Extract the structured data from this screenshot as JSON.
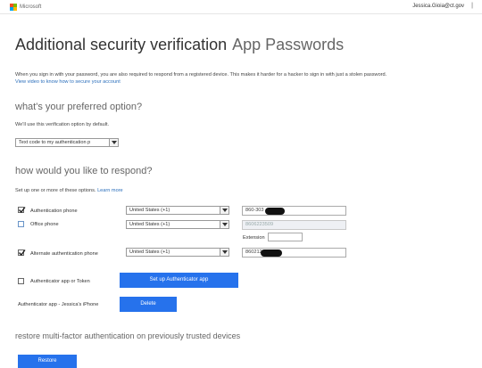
{
  "header": {
    "brand": "Microsoft",
    "user_email": "Jessica.Gioia@ct.gov",
    "separator": "|",
    "logo_colors": [
      "#f25022",
      "#7fba00",
      "#00a4ef",
      "#ffb900"
    ]
  },
  "title": {
    "main": "Additional security verification",
    "sub": "App Passwords"
  },
  "intro": {
    "text": "When you sign in with your password, you are also required to respond from a registered device. This makes it harder for a hacker to sign in with just a stolen password.",
    "link": "View video to know how to secure your account"
  },
  "preferred": {
    "heading": "what's your preferred option?",
    "description": "We'll use this verification option by default.",
    "selected": "Text code to my authentication p"
  },
  "respond": {
    "heading": "how would you like to respond?",
    "description": "Set up one or more of these options.",
    "learn_more": "Learn more",
    "rows": [
      {
        "label": "Authentication phone",
        "checked": true,
        "country": "United States (+1)",
        "number": "860-303"
      },
      {
        "label": "Office phone",
        "checked": false,
        "country": "United States (+1)",
        "number": "8606223509",
        "extension_label": "Extension"
      },
      {
        "label": "Alternate authentication phone",
        "checked": true,
        "country": "United States (+1)",
        "number": "860212"
      }
    ],
    "authenticator": {
      "label": "Authenticator app or Token",
      "checked": false,
      "setup_button": "Set up Authenticator app",
      "device_label": "Authenticator app - Jessica's iPhone",
      "delete_button": "Delete"
    }
  },
  "restore": {
    "heading": "restore multi-factor authentication on previously trusted devices",
    "button": "Restore"
  },
  "colors": {
    "accent": "#2672ec",
    "link": "#2a6ebb"
  }
}
